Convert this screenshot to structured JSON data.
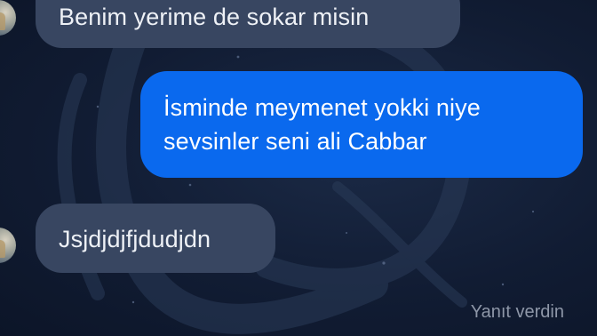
{
  "messages": [
    {
      "direction": "incoming",
      "text": "Benim yerime de sokar misin"
    },
    {
      "direction": "outgoing",
      "text": "İsminde meymenet yokki niye sevsinler seni ali Cabbar"
    },
    {
      "direction": "incoming",
      "text": "Jsjdjdjfjdudjdn"
    }
  ],
  "status": {
    "reply_text": "Yanıt verdin"
  },
  "colors": {
    "incoming_bubble": "#384661",
    "outgoing_bubble": "#0a69ee",
    "background": "#111c33",
    "status_text": "#8e97a8"
  }
}
